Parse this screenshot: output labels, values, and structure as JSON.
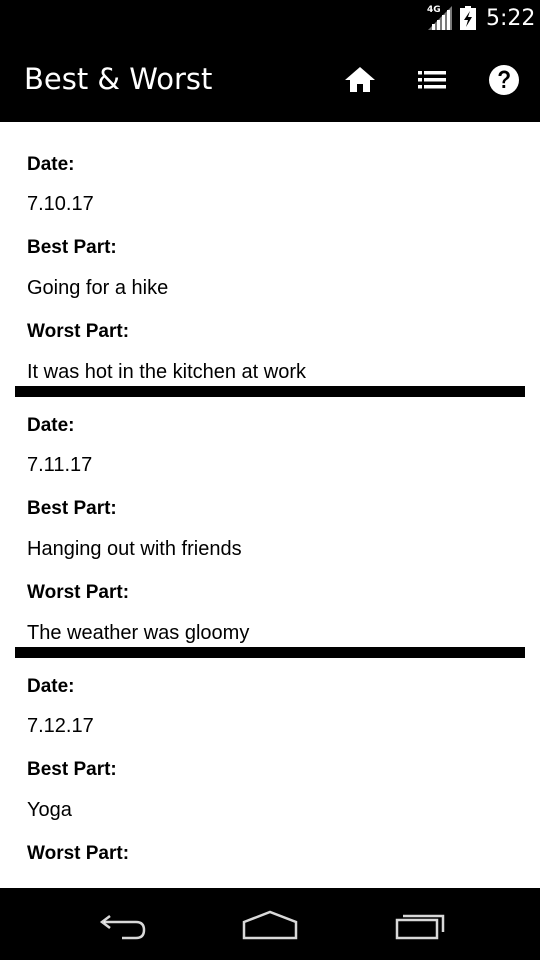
{
  "status_bar": {
    "network": "4G",
    "time": "5:22",
    "icons": [
      "signal-icon",
      "battery-charging-icon"
    ]
  },
  "action_bar": {
    "title": "Best & Worst",
    "icons": [
      "home-icon",
      "list-icon",
      "help-icon"
    ]
  },
  "labels": {
    "date": "Date:",
    "best": "Best Part:",
    "worst": "Worst Part:"
  },
  "entries": [
    {
      "date": "7.10.17",
      "best": "Going for a hike",
      "worst": "It was hot in the kitchen at work"
    },
    {
      "date": "7.11.17",
      "best": "Hanging out with friends",
      "worst": "The weather was gloomy"
    },
    {
      "date": "7.12.17",
      "best": "Yoga",
      "worst": ""
    }
  ],
  "nav_bar": {
    "icons": [
      "back-icon",
      "home-nav-icon",
      "recents-icon"
    ]
  }
}
